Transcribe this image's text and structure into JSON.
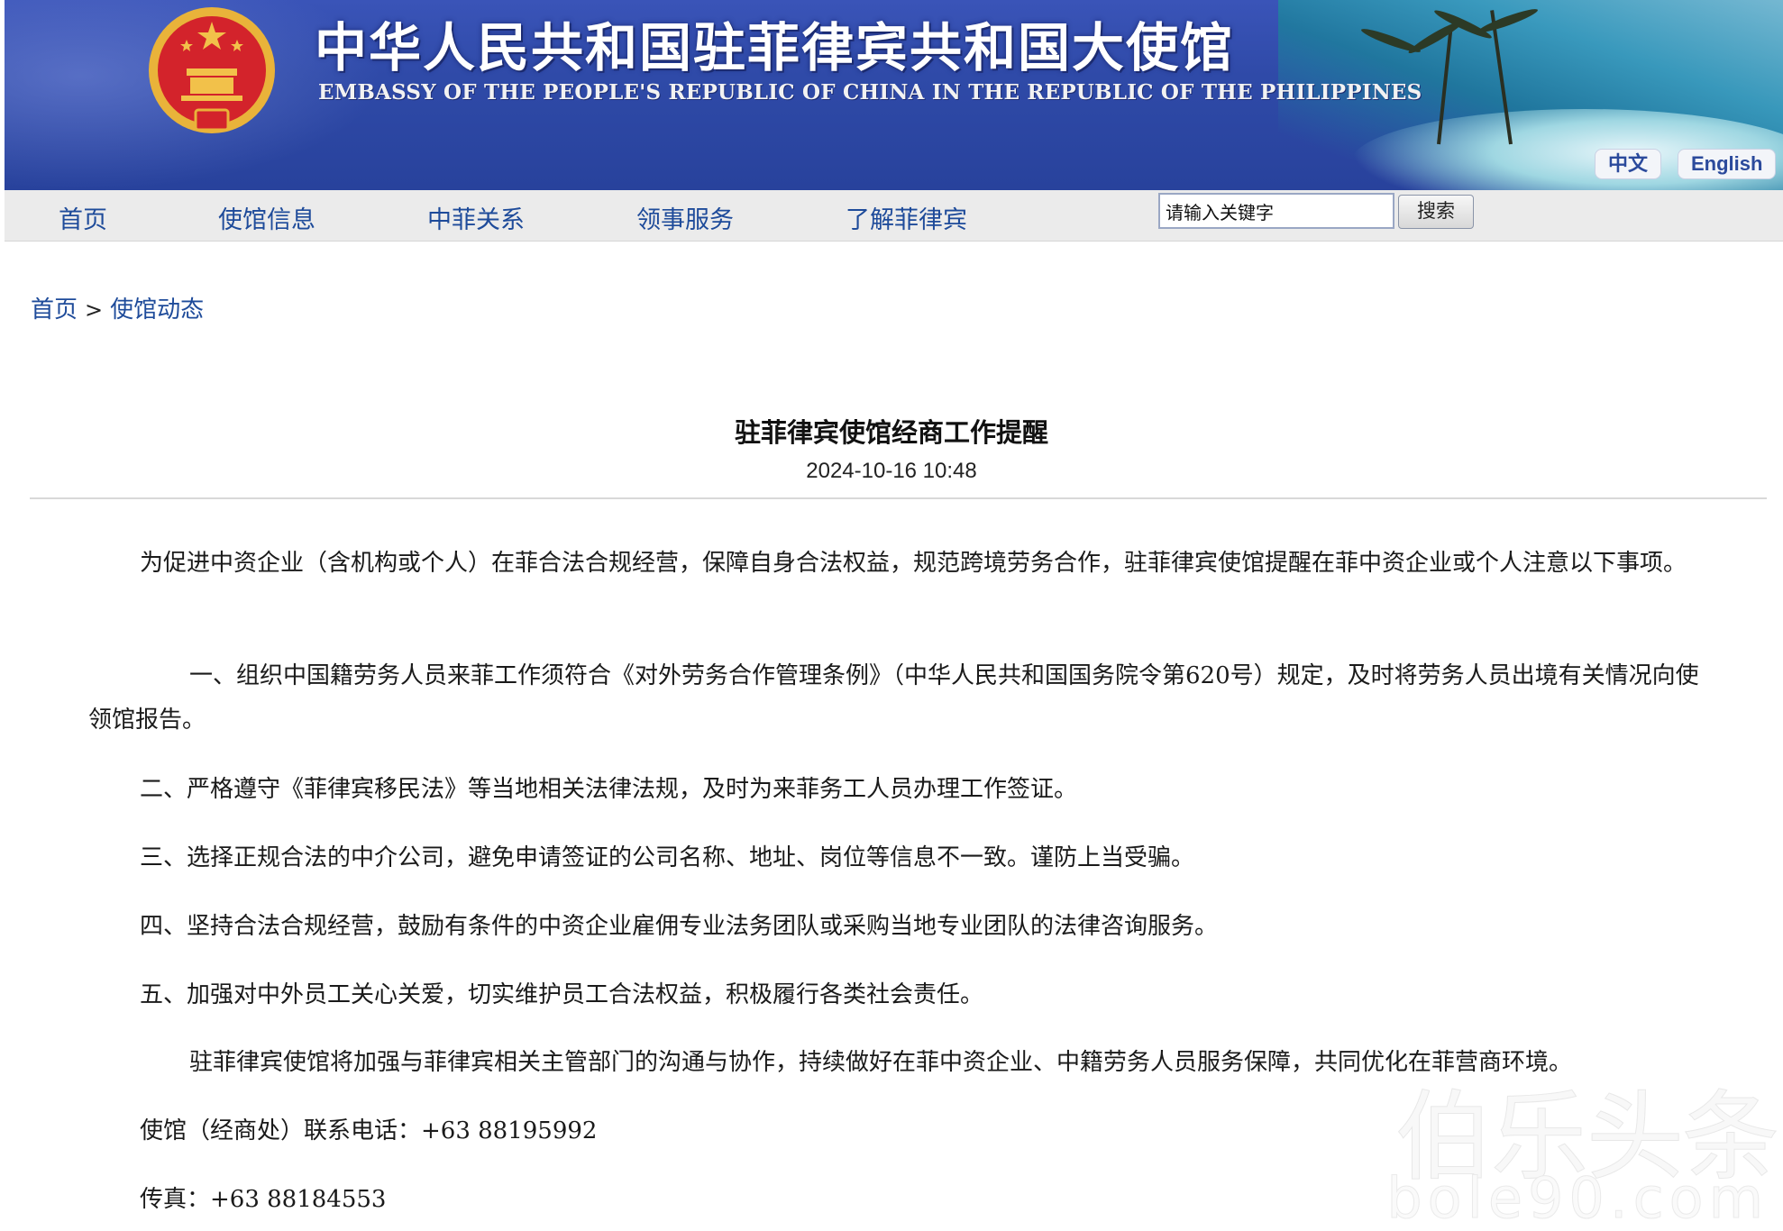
{
  "header": {
    "title_cn": "中华人民共和国驻菲律宾共和国大使馆",
    "title_en": "EMBASSY OF THE PEOPLE'S REPUBLIC OF CHINA IN THE REPUBLIC OF THE PHILIPPINES",
    "lang_cn": "中文",
    "lang_en": "English",
    "colors": {
      "banner": "#2f4aa8",
      "link": "#1e4b9a",
      "nav_bg": "#ebebeb"
    }
  },
  "nav": {
    "items": [
      "首页",
      "使馆信息",
      "中菲关系",
      "领事服务",
      "了解菲律宾"
    ]
  },
  "search": {
    "value": "请输入关键字",
    "button": "搜索"
  },
  "breadcrumb": {
    "home": "首页",
    "sep": ">",
    "current": "使馆动态"
  },
  "article": {
    "title": "驻菲律宾使馆经商工作提醒",
    "date": "2024-10-16 10:48",
    "p1": "为促进中资企业（含机构或个人）在菲合法合规经营，保障自身合法权益，规范跨境劳务合作，驻菲律宾使馆提醒在菲中资企业或个人注意以下事项。",
    "p2": "一、组织中国籍劳务人员来菲工作须符合《对外劳务合作管理条例》（中华人民共和国国务院令第620号）规定，及时将劳务人员出境有关情况向使领馆报告。",
    "p3": "二、严格遵守《菲律宾移民法》等当地相关法律法规，及时为来菲务工人员办理工作签证。",
    "p4": "三、选择正规合法的中介公司，避免申请签证的公司名称、地址、岗位等信息不一致。谨防上当受骗。",
    "p5": "四、坚持合法合规经营，鼓励有条件的中资企业雇佣专业法务团队或采购当地专业团队的法律咨询服务。",
    "p6": "五、加强对中外员工关心关爱，切实维护员工合法权益，积极履行各类社会责任。",
    "p7": "驻菲律宾使馆将加强与菲律宾相关主管部门的沟通与协作，持续做好在菲中资企业、中籍劳务人员服务保障，共同优化在菲营商环境。",
    "p8": "使馆（经商处）联系电话：+63 88195992",
    "p9": "传真：+63 88184553"
  },
  "watermark": {
    "line1": "伯乐头条",
    "line2": "bole90.com"
  }
}
